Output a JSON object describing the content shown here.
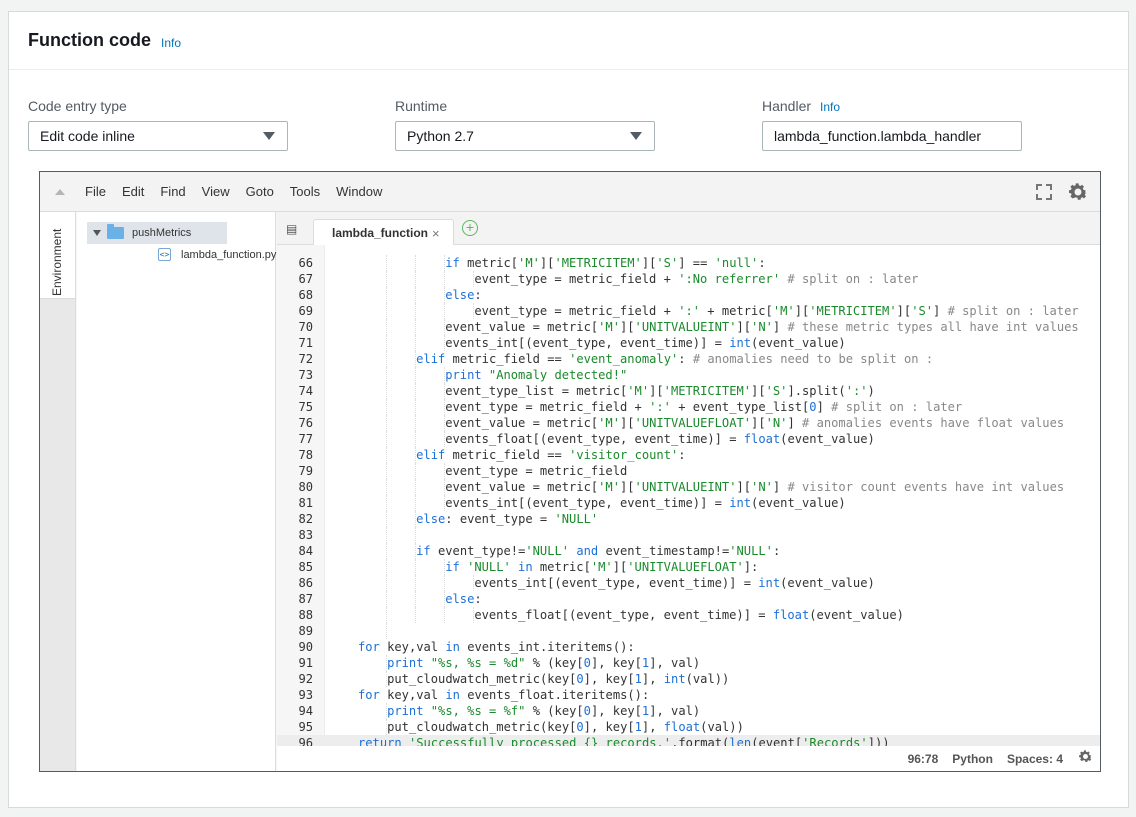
{
  "header": {
    "title": "Function code",
    "info": "Info"
  },
  "fields": {
    "entry_type": {
      "label": "Code entry type",
      "value": "Edit code inline"
    },
    "runtime": {
      "label": "Runtime",
      "value": "Python 2.7"
    },
    "handler": {
      "label": "Handler",
      "info": "Info",
      "value": "lambda_function.lambda_handler"
    }
  },
  "menu": [
    "File",
    "Edit",
    "Find",
    "View",
    "Goto",
    "Tools",
    "Window"
  ],
  "sidebar": {
    "environment_label": "Environment"
  },
  "tree": {
    "folder": "pushMetrics",
    "file": "lambda_function.py"
  },
  "tab": {
    "label": "lambda_function",
    "close": "×"
  },
  "code_lines": [
    {
      "n": "66",
      "indent": 4,
      "html": "<span class=\"kw\">if</span> metric[<span class=\"str\">'M'</span>][<span class=\"str\">'METRICITEM'</span>][<span class=\"str\">'S'</span>] == <span class=\"str\">'null'</span>:"
    },
    {
      "n": "67",
      "indent": 5,
      "html": "event_type = metric_field + <span class=\"str\">':No referrer'</span> <span class=\"cm\"># split on : later</span>"
    },
    {
      "n": "68",
      "indent": 4,
      "html": "<span class=\"kw\">else</span>:"
    },
    {
      "n": "69",
      "indent": 5,
      "html": "event_type = metric_field + <span class=\"str\">':'</span> + metric[<span class=\"str\">'M'</span>][<span class=\"str\">'METRICITEM'</span>][<span class=\"str\">'S'</span>] <span class=\"cm\"># split on : later</span>"
    },
    {
      "n": "70",
      "indent": 4,
      "html": "event_value = metric[<span class=\"str\">'M'</span>][<span class=\"str\">'UNITVALUEINT'</span>][<span class=\"str\">'N'</span>] <span class=\"cm\"># these metric types all have int values</span>"
    },
    {
      "n": "71",
      "indent": 4,
      "html": "events_int[(event_type, event_time)] = <span class=\"kw\">int</span>(event_value)"
    },
    {
      "n": "72",
      "indent": 3,
      "html": "<span class=\"kw\">elif</span> metric_field == <span class=\"str\">'event_anomaly'</span>: <span class=\"cm\"># anomalies need to be split on :</span>"
    },
    {
      "n": "73",
      "indent": 4,
      "html": "<span class=\"kw\">print</span> <span class=\"str\">\"Anomaly detected!\"</span>"
    },
    {
      "n": "74",
      "indent": 4,
      "html": "event_type_list = metric[<span class=\"str\">'M'</span>][<span class=\"str\">'METRICITEM'</span>][<span class=\"str\">'S'</span>].split(<span class=\"str\">':'</span>)"
    },
    {
      "n": "75",
      "indent": 4,
      "html": "event_type = metric_field + <span class=\"str\">':'</span> + event_type_list[<span class=\"kw\">0</span>] <span class=\"cm\"># split on : later</span>"
    },
    {
      "n": "76",
      "indent": 4,
      "html": "event_value = metric[<span class=\"str\">'M'</span>][<span class=\"str\">'UNITVALUEFLOAT'</span>][<span class=\"str\">'N'</span>] <span class=\"cm\"># anomalies events have float values</span>"
    },
    {
      "n": "77",
      "indent": 4,
      "html": "events_float[(event_type, event_time)] = <span class=\"kw\">float</span>(event_value)"
    },
    {
      "n": "78",
      "indent": 3,
      "html": "<span class=\"kw\">elif</span> metric_field == <span class=\"str\">'visitor_count'</span>:"
    },
    {
      "n": "79",
      "indent": 4,
      "html": "event_type = metric_field"
    },
    {
      "n": "80",
      "indent": 4,
      "html": "event_value = metric[<span class=\"str\">'M'</span>][<span class=\"str\">'UNITVALUEINT'</span>][<span class=\"str\">'N'</span>] <span class=\"cm\"># visitor count events have int values</span>"
    },
    {
      "n": "81",
      "indent": 4,
      "html": "events_int[(event_type, event_time)] = <span class=\"kw\">int</span>(event_value)"
    },
    {
      "n": "82",
      "indent": 3,
      "html": "<span class=\"kw\">else</span>: event_type = <span class=\"str\">'NULL'</span>"
    },
    {
      "n": "83",
      "indent": 3,
      "html": ""
    },
    {
      "n": "84",
      "indent": 3,
      "html": "<span class=\"kw\">if</span> event_type!=<span class=\"str\">'NULL'</span> <span class=\"kw\">and</span> event_timestamp!=<span class=\"str\">'NULL'</span>:"
    },
    {
      "n": "85",
      "indent": 4,
      "html": "<span class=\"kw\">if</span> <span class=\"str\">'NULL'</span> <span class=\"kw\">in</span> metric[<span class=\"str\">'M'</span>][<span class=\"str\">'UNITVALUEFLOAT'</span>]:"
    },
    {
      "n": "86",
      "indent": 5,
      "html": "events_int[(event_type, event_time)] = <span class=\"kw\">int</span>(event_value)"
    },
    {
      "n": "87",
      "indent": 4,
      "html": "<span class=\"kw\">else</span>:"
    },
    {
      "n": "88",
      "indent": 5,
      "html": "events_float[(event_type, event_time)] = <span class=\"kw\">float</span>(event_value)"
    },
    {
      "n": "89",
      "indent": 2,
      "html": ""
    },
    {
      "n": "90",
      "indent": 1,
      "html": "<span class=\"kw\">for</span> key,val <span class=\"kw\">in</span> events_int.iteritems():"
    },
    {
      "n": "91",
      "indent": 2,
      "html": "<span class=\"kw\">print</span> <span class=\"str\">\"%s, %s = %d\"</span> % (key[<span class=\"kw\">0</span>], key[<span class=\"kw\">1</span>], val)"
    },
    {
      "n": "92",
      "indent": 2,
      "html": "put_cloudwatch_metric(key[<span class=\"kw\">0</span>], key[<span class=\"kw\">1</span>], <span class=\"kw\">int</span>(val))"
    },
    {
      "n": "93",
      "indent": 1,
      "html": "<span class=\"kw\">for</span> key,val <span class=\"kw\">in</span> events_float.iteritems():"
    },
    {
      "n": "94",
      "indent": 2,
      "html": "<span class=\"kw\">print</span> <span class=\"str\">\"%s, %s = %f\"</span> % (key[<span class=\"kw\">0</span>], key[<span class=\"kw\">1</span>], val)"
    },
    {
      "n": "95",
      "indent": 2,
      "html": "put_cloudwatch_metric(key[<span class=\"kw\">0</span>], key[<span class=\"kw\">1</span>], <span class=\"kw\">float</span>(val))"
    },
    {
      "n": "96",
      "indent": 1,
      "active": true,
      "html": "<span class=\"kw\">return</span> <span class=\"str\">'Successfully processed {} records.'</span>.format(<span class=\"kw\">len</span>(event[<span class=\"str\">'Records'</span>]))"
    }
  ],
  "status": {
    "cursor": "96:78",
    "language": "Python",
    "spaces": "Spaces: 4"
  },
  "icons": {
    "gear": "gear-icon",
    "fullscreen": "fullscreen-icon",
    "collapse": "collapse-icon"
  }
}
